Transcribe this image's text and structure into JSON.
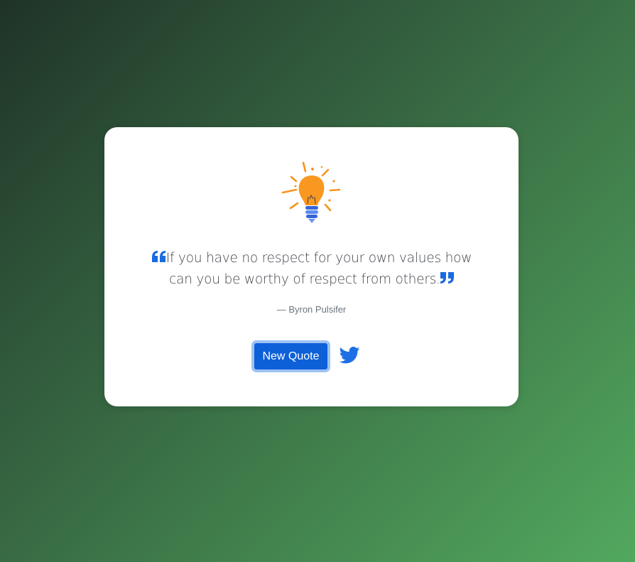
{
  "quote": {
    "text": "If you have no respect for your own values how can you be worthy of respect from others.",
    "author": "— Byron Pulsifer"
  },
  "actions": {
    "new_quote_label": "New Quote",
    "share_icon": "twitter-icon"
  },
  "colors": {
    "accent": "#0d60d8",
    "quote_marks": "#1a6be0",
    "bulb": "#f7941d",
    "twitter": "#1d6fe6"
  }
}
